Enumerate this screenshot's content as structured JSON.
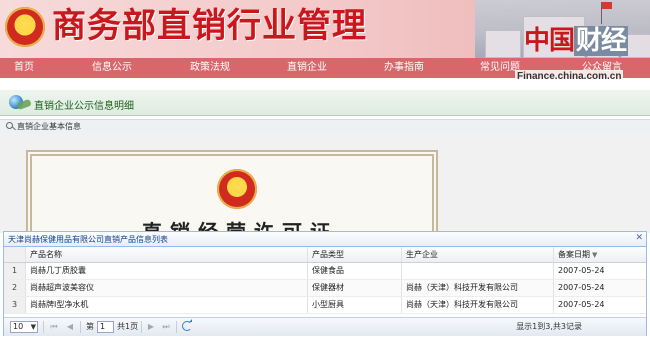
{
  "header": {
    "site_title": "商务部直销行业管理",
    "brand_logo_main": "中国",
    "brand_logo_sub": "财经",
    "brand_url": "Finance.china.com.cn"
  },
  "nav": {
    "items": [
      {
        "label": "首页"
      },
      {
        "label": "信息公示"
      },
      {
        "label": "政策法规"
      },
      {
        "label": "直销企业"
      },
      {
        "label": "办事指南"
      },
      {
        "label": "常见问题"
      },
      {
        "label": "公众留言"
      }
    ]
  },
  "page_title": "直销企业公示信息明细",
  "panel_title": "直销企业基本信息",
  "certificate": {
    "title": "直销经营许可证"
  },
  "grid": {
    "title": "天津尚赫保健用品有限公司直销产品信息列表",
    "columns": [
      "产品名称",
      "产品类型",
      "生产企业",
      "备案日期"
    ],
    "rows": [
      {
        "num": "1",
        "name": "尚赫几丁质胶囊",
        "type": "保健食品",
        "maker": "",
        "date": "2007-05-24"
      },
      {
        "num": "2",
        "name": "尚赫超声波美容仪",
        "type": "保健器材",
        "maker": "尚赫（天津）科技开发有限公司",
        "date": "2007-05-24"
      },
      {
        "num": "3",
        "name": "尚赫牌Ⅰ型净水机",
        "type": "小型厨具",
        "maker": "尚赫（天津）科技开发有限公司",
        "date": "2007-05-24"
      }
    ],
    "pager": {
      "page_size": "10",
      "page_prefix": "第",
      "current_page": "1",
      "total_pages": "共1页",
      "info": "显示1到3,共3记录"
    }
  },
  "colors": {
    "brand_red": "#c8181d",
    "nav_bg": "#d9666b",
    "grid_border": "#99bbe8"
  }
}
